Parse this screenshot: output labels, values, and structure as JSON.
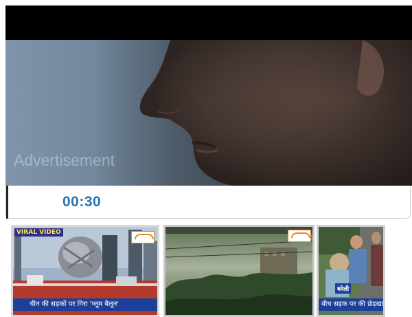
{
  "player": {
    "ad_label": "Advertisement",
    "current_time": "00:30"
  },
  "thumbnails": [
    {
      "badge": "VIRAL VIDEO",
      "caption": "चीन की सड़कों पर गिरा 'ग्लूम बैलून'",
      "logo": "news-channel-logo"
    },
    {
      "badge": "",
      "caption": "",
      "logo": "news-channel-logo"
    },
    {
      "badge": "बरेली",
      "caption": "बीच सड़क पर की छेड़खानी",
      "logo": ""
    }
  ],
  "colors": {
    "time_text": "#2a73b3",
    "caption_bg": "#1c3f9a",
    "badge_bg": "#2d2f8f",
    "badge_text": "#ffeb3b"
  }
}
